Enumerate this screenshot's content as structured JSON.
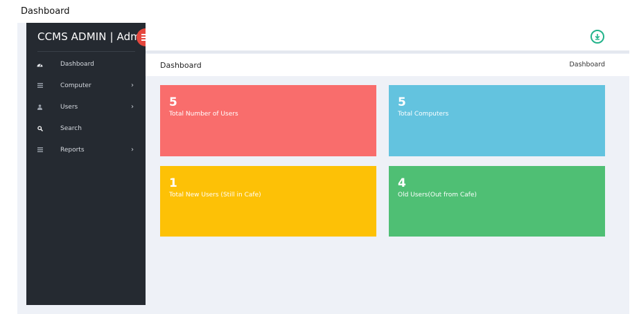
{
  "page_caption": "Dashboard",
  "sidebar": {
    "brand": "CCMS ADMIN | Admin",
    "items": [
      {
        "label": "Dashboard",
        "icon": "dashboard-icon",
        "has_chevron": false
      },
      {
        "label": "Computer",
        "icon": "list-icon",
        "has_chevron": true
      },
      {
        "label": "Users",
        "icon": "user-icon",
        "has_chevron": true
      },
      {
        "label": "Search",
        "icon": "search-icon",
        "has_chevron": false
      },
      {
        "label": "Reports",
        "icon": "list-icon",
        "has_chevron": true
      }
    ],
    "chevron": "›"
  },
  "header": {
    "title": "Dashboard",
    "breadcrumb": "Dashboard"
  },
  "cards": [
    {
      "count": "5",
      "label": "Total Number of Users",
      "color": "#f96d6c"
    },
    {
      "count": "5",
      "label": "Total Computers",
      "color": "#63c3df"
    },
    {
      "count": "1",
      "label": "Total New Users (Still in Cafe)",
      "color": "#fdc106"
    },
    {
      "count": "4",
      "label": "Old Users(Out from Cafe)",
      "color": "#4fbf74"
    }
  ],
  "colors": {
    "sidebar_bg": "#252a31",
    "accent_red": "#e5473e",
    "accent_green": "#22b38a",
    "content_bg": "#eef1f7"
  }
}
